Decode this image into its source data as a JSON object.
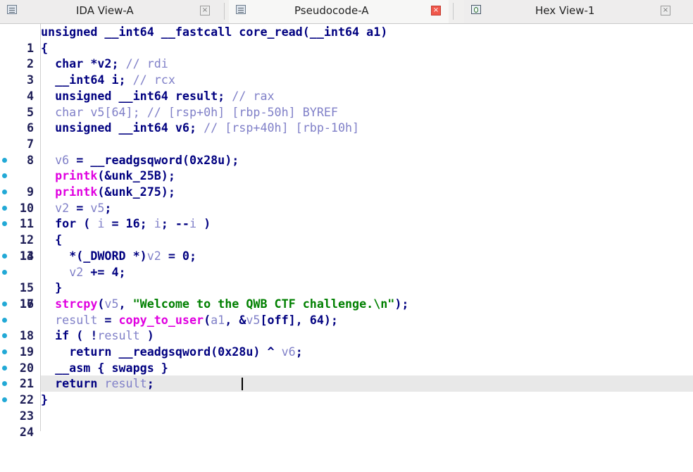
{
  "tabs": [
    {
      "label": "IDA View-A",
      "icon": "listing-icon"
    },
    {
      "label": "Pseudocode-A",
      "icon": "pseudocode-icon"
    },
    {
      "label": "Hex View-1",
      "icon": "hex-icon"
    }
  ],
  "tab_close_glyph": "×",
  "active_tab": "Pseudocode-A",
  "code": {
    "line_numbers": [
      "1",
      "2",
      "3",
      "4",
      "5",
      "6",
      "7",
      "8",
      "9",
      "10",
      "11",
      "12",
      "13",
      "14",
      "15",
      "16",
      "17",
      "18",
      "19",
      "20",
      "21",
      "22",
      "23",
      "24"
    ],
    "text": {
      "l1": "unsigned __int64 __fastcall core_read(__int64 a1)",
      "l2": "{",
      "l3_decl": "char *v2; ",
      "l3_cm": "// rdi",
      "l4_decl": "__int64 i; ",
      "l4_cm": "// rcx",
      "l5_decl": "unsigned __int64 result; ",
      "l5_cm": "// rax",
      "l6_decl": "char v5[64]; ",
      "l6_cm": "// [rsp+0h] [rbp-50h] BYREF",
      "l7_decl": "unsigned __int64 v6; ",
      "l7_cm": "// [rsp+40h] [rbp-10h]",
      "v6": "v6",
      "v2": "v2",
      "v5": "v5",
      "i": "i",
      "a1": "a1",
      "result": "result",
      "off": "off",
      "eq": " = ",
      "readgs_call": "__readgsqword(0x28u);",
      "readgs_ret": "__readgsqword(0x28u) ^ ",
      "printk": "printk",
      "unk_25B": "(&unk_25B);",
      "unk_275": "(&unk_275);",
      "semi": ";",
      "for_open": "for ( ",
      "for_mid1": " = 16; ",
      "for_mid2": "; --",
      "for_close": " )",
      "brace_open": "{",
      "brace_close": "}",
      "dword_cast": "*(_DWORD *)",
      "assign_zero": " = 0;",
      "plus_eq": " += 4;",
      "strcpy": "strcpy",
      "paren_open": "(",
      "comma_sp": ", ",
      "str_welcome": "\"Welcome to the QWB CTF challenge.\\n\"",
      "close_semi": ");",
      "copy_to_user": "copy_to_user",
      "amp": "&",
      "bracket_open": "[",
      "bracket_close_tail": "], 64);",
      "if_open": "if ( !",
      "if_close": " )",
      "return_kw": "return ",
      "asm": "__asm { swapgs }"
    },
    "current_line": 23,
    "colors": {
      "keyword": "#000080",
      "variable": "#8080c8",
      "function": "#e000e0",
      "string": "#008000",
      "breakpoint_dot": "#22a9d6"
    }
  }
}
